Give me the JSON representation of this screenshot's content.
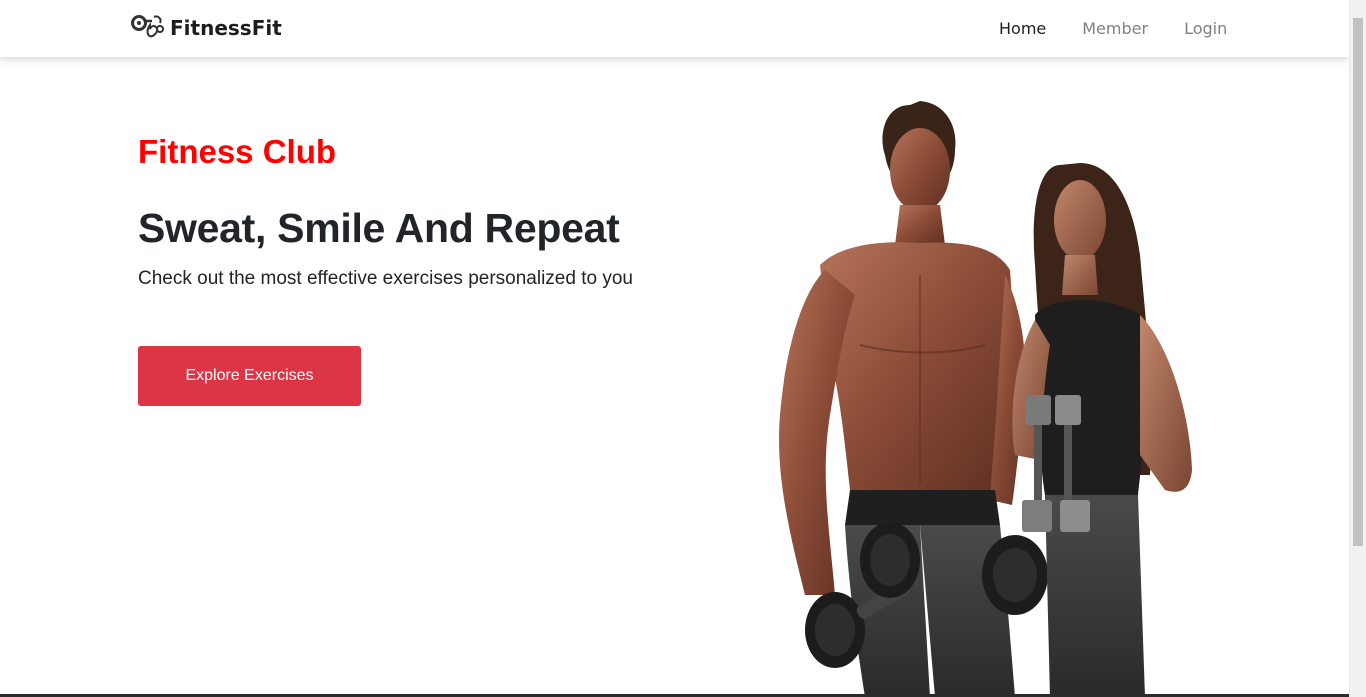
{
  "navbar": {
    "brand": {
      "name": "FitnessFit",
      "logo_icon": "barbell-heart-logo-icon"
    },
    "links": [
      {
        "label": "Home",
        "active": true
      },
      {
        "label": "Member",
        "active": false
      },
      {
        "label": "Login",
        "active": false
      }
    ]
  },
  "hero": {
    "tagline": "Fitness Club",
    "headline": "Sweat, Smile And Repeat",
    "subtext": "Check out the most effective exercises personalized to you",
    "cta_label": "Explore Exercises",
    "image_alt": "fitness-couple-with-dumbbells"
  },
  "colors": {
    "accent_red": "#ff0000",
    "button_red": "#dc3545",
    "text_dark": "#212529",
    "nav_muted": "#808080"
  }
}
